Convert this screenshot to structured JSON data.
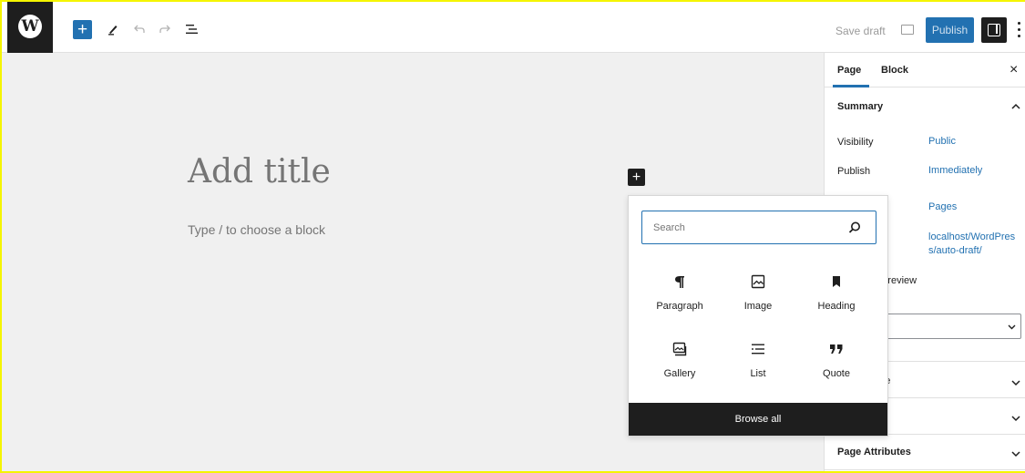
{
  "toolbar": {
    "logo_letter": "W",
    "add_block_symbol": "+",
    "save_draft_label": "Save draft",
    "publish_label": "Publish"
  },
  "editor": {
    "title_placeholder": "Add title",
    "block_placeholder": "Type / to choose a block",
    "inserter_symbol": "+"
  },
  "sidebar": {
    "tabs": [
      {
        "label": "Page",
        "active": true
      },
      {
        "label": "Block",
        "active": false
      }
    ],
    "close_symbol": "×",
    "summary": {
      "heading": "Summary",
      "rows": [
        {
          "label": "Visibility",
          "value": "Public"
        },
        {
          "label": "Publish",
          "value": "Immediately"
        },
        {
          "label": "",
          "value": "Pages"
        },
        {
          "label": "",
          "value": "localhost/WordPres s/auto-draft/"
        }
      ],
      "pending_review_partial": "ng review"
    },
    "panels": [
      {
        "heading": "age"
      },
      {
        "heading": ""
      },
      {
        "heading": "Page Attributes"
      }
    ]
  },
  "inserter": {
    "search_placeholder": "Search",
    "blocks": [
      {
        "label": "Paragraph",
        "icon": "paragraph-icon"
      },
      {
        "label": "Image",
        "icon": "image-icon"
      },
      {
        "label": "Heading",
        "icon": "heading-icon"
      },
      {
        "label": "Gallery",
        "icon": "gallery-icon"
      },
      {
        "label": "List",
        "icon": "list-icon"
      },
      {
        "label": "Quote",
        "icon": "quote-icon"
      }
    ],
    "browse_all_label": "Browse all"
  },
  "colors": {
    "accent": "#2271b1",
    "dark": "#1e1e1e",
    "canvas_bg": "#f0f0f0"
  }
}
